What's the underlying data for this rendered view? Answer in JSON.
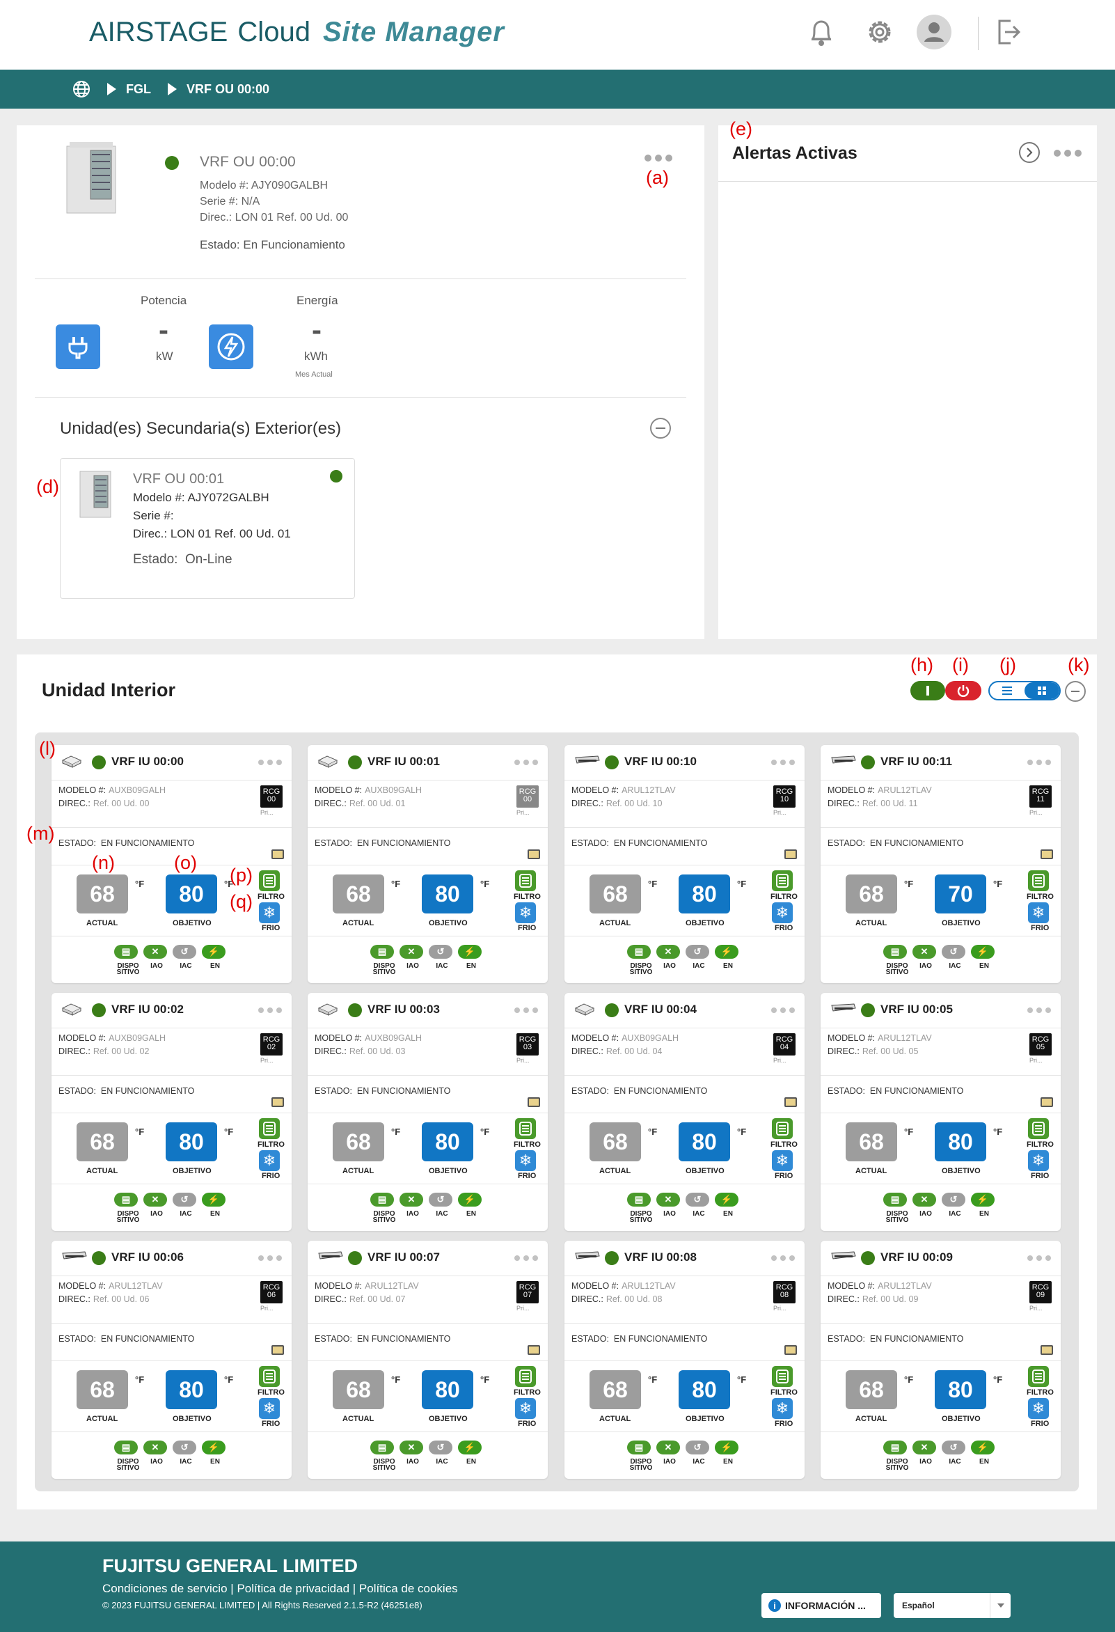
{
  "header": {
    "brand_main": "AIRSTAGE",
    "brand_cloud": "Cloud",
    "brand_site": "Site Manager"
  },
  "breadcrumb": {
    "level1": "FGL",
    "level2": "VRF OU 00:00"
  },
  "outdoor": {
    "name": "VRF OU 00:00",
    "model": "Modelo #: AJY090GALBH",
    "serial": "Serie #: N/A",
    "address": "Direc.: LON 01 Ref. 00 Ud. 00",
    "state_label": "Estado:",
    "state_value": "En Funcionamiento"
  },
  "power": {
    "label": "Potencia",
    "value": "-",
    "unit": "kW"
  },
  "energy": {
    "label": "Energía",
    "value": "-",
    "unit": "kWh",
    "period": "Mes Actual"
  },
  "secondary": {
    "title": "Unidad(es) Secundaria(s) Exterior(es)",
    "name": "VRF OU 00:01",
    "model": "Modelo #: AJY072GALBH",
    "serial": "Serie #:",
    "address": "Direc.: LON 01 Ref. 00 Ud. 01",
    "state_label": "Estado:",
    "state_value": "On-Line"
  },
  "alerts": {
    "title": "Alertas Activas"
  },
  "indoor": {
    "title": "Unidad Interior",
    "model_label": "MODELO #:",
    "addr_label": "DIREC.:",
    "state_label": "ESTADO:",
    "state_value": "EN FUNCIONAMIENTO",
    "unit": "°F",
    "actual_label": "ACTUAL",
    "target_label": "OBJETIVO",
    "filter_label": "FILTRO",
    "mode_label": "FRIO",
    "rcg_label": "RCG",
    "pri_label": "Pri...",
    "pill_labels": [
      "DISPO SITIVO",
      "IAO",
      "IAC",
      "EN"
    ],
    "units": [
      {
        "name": "VRF IU 00:00",
        "model": "AUXB09GALH",
        "addr": "Ref. 00 Ud. 00",
        "rcg": "00",
        "actual": "68",
        "target": "80",
        "type": "cassette"
      },
      {
        "name": "VRF IU 00:01",
        "model": "AUXB09GALH",
        "addr": "Ref. 00 Ud. 01",
        "rcg": "00",
        "actual": "68",
        "target": "80",
        "type": "cassette"
      },
      {
        "name": "VRF IU 00:10",
        "model": "ARUL12TLAV",
        "addr": "Ref. 00 Ud. 10",
        "rcg": "10",
        "actual": "68",
        "target": "80",
        "type": "duct"
      },
      {
        "name": "VRF IU 00:11",
        "model": "ARUL12TLAV",
        "addr": "Ref. 00 Ud. 11",
        "rcg": "11",
        "actual": "68",
        "target": "70",
        "type": "duct"
      },
      {
        "name": "VRF IU 00:02",
        "model": "AUXB09GALH",
        "addr": "Ref. 00 Ud. 02",
        "rcg": "02",
        "actual": "68",
        "target": "80",
        "type": "cassette"
      },
      {
        "name": "VRF IU 00:03",
        "model": "AUXB09GALH",
        "addr": "Ref. 00 Ud. 03",
        "rcg": "03",
        "actual": "68",
        "target": "80",
        "type": "cassette"
      },
      {
        "name": "VRF IU 00:04",
        "model": "AUXB09GALH",
        "addr": "Ref. 00 Ud. 04",
        "rcg": "04",
        "actual": "68",
        "target": "80",
        "type": "cassette"
      },
      {
        "name": "VRF IU 00:05",
        "model": "ARUL12TLAV",
        "addr": "Ref. 00 Ud. 05",
        "rcg": "05",
        "actual": "68",
        "target": "80",
        "type": "duct"
      },
      {
        "name": "VRF IU 00:06",
        "model": "ARUL12TLAV",
        "addr": "Ref. 00 Ud. 06",
        "rcg": "06",
        "actual": "68",
        "target": "80",
        "type": "duct"
      },
      {
        "name": "VRF IU 00:07",
        "model": "ARUL12TLAV",
        "addr": "Ref. 00 Ud. 07",
        "rcg": "07",
        "actual": "68",
        "target": "80",
        "type": "duct"
      },
      {
        "name": "VRF IU 00:08",
        "model": "ARUL12TLAV",
        "addr": "Ref. 00 Ud. 08",
        "rcg": "08",
        "actual": "68",
        "target": "80",
        "type": "duct"
      },
      {
        "name": "VRF IU 00:09",
        "model": "ARUL12TLAV",
        "addr": "Ref. 00 Ud. 09",
        "rcg": "09",
        "actual": "68",
        "target": "80",
        "type": "duct"
      }
    ]
  },
  "annotations": {
    "a": "(a)",
    "d": "(d)",
    "e": "(e)",
    "h": "(h)",
    "i": "(i)",
    "j": "(j)",
    "k": "(k)",
    "l": "(l)",
    "m": "(m)",
    "n": "(n)",
    "o": "(o)",
    "p": "(p)",
    "q": "(q)"
  },
  "footer": {
    "company": "FUJITSU GENERAL LIMITED",
    "terms": "Condiciones de servicio",
    "privacy": "Política de privacidad",
    "cookies": "Política de cookies",
    "sep": "|",
    "copyright": "© 2023 FUJITSU GENERAL LIMITED | All Rights Reserved 2.1.5-R2 (46251e8)",
    "info_button": "INFORMACIÓN ...",
    "language": "Español"
  },
  "colors": {
    "teal": "#236f72",
    "green": "#3a7d17",
    "blue": "#1176c4",
    "red": "#d9232d"
  }
}
